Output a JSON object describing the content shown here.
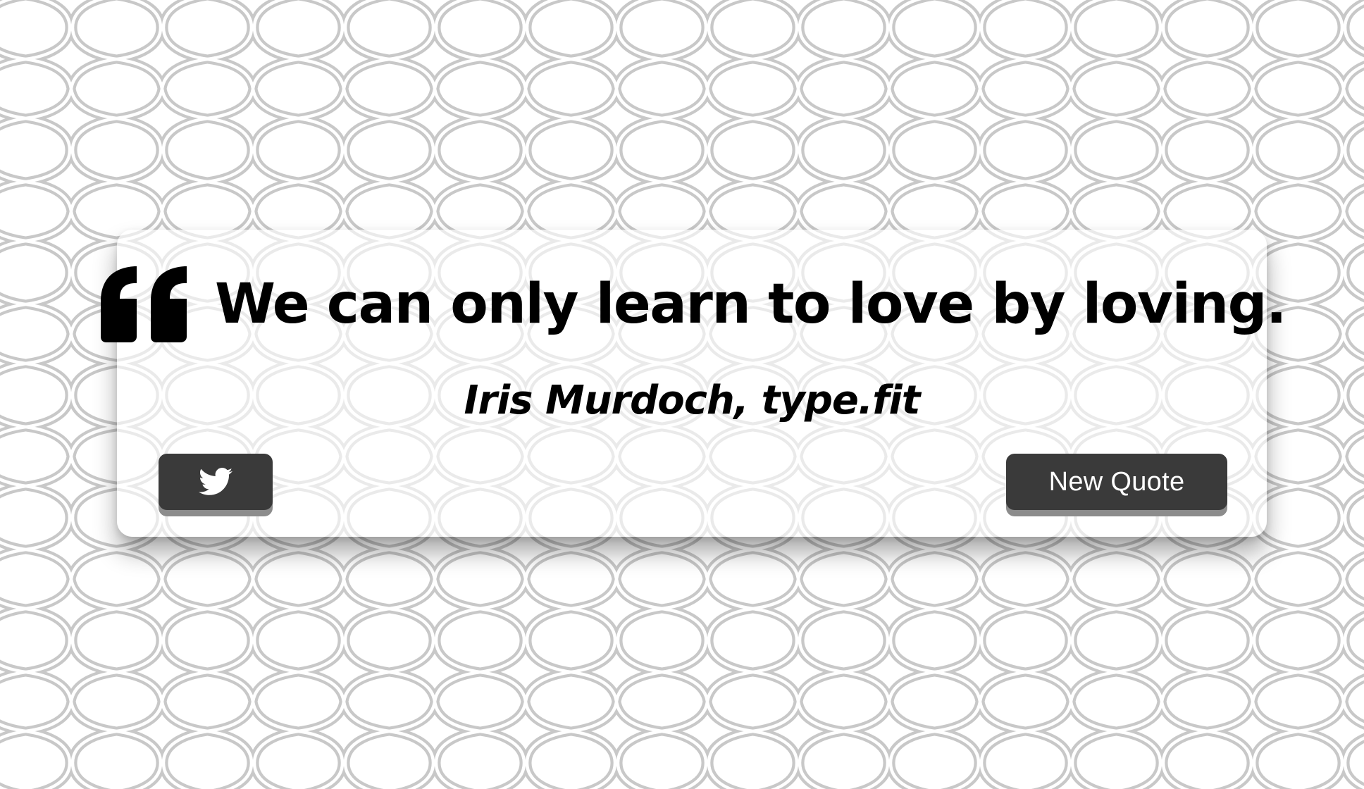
{
  "background": {
    "pattern": "moroccan-lattice",
    "pattern_color": "#c9c9c9",
    "base_color": "#ffffff"
  },
  "quote_box": {
    "quote_icon": "quote-left-icon",
    "quote_text": "We can only learn to love by loving.",
    "author": "Iris Murdoch, type.fit"
  },
  "actions": {
    "tweet_icon": "twitter-icon",
    "new_quote_label": "New Quote",
    "button_color": "#3a3a3a"
  }
}
